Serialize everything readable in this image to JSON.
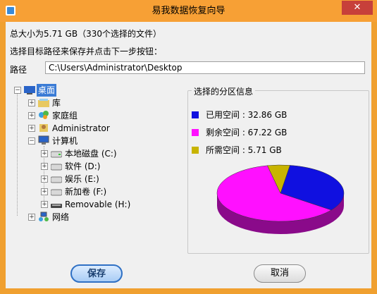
{
  "window": {
    "title": "易我数据恢复向导",
    "close_label": "✕"
  },
  "summary": {
    "total_size_text": "总大小为5.71 GB（330个选择的文件）"
  },
  "prompt": {
    "text": "选择目标路径来保存并点击下一步按钮："
  },
  "path": {
    "label": "路径",
    "value": "C:\\Users\\Administrator\\Desktop"
  },
  "tree": {
    "desktop": "桌面",
    "library": "库",
    "homegroup": "家庭组",
    "administrator": "Administrator",
    "computer": "计算机",
    "drive_c": "本地磁盘 (C:)",
    "drive_d": "软件 (D:)",
    "drive_e": "娱乐 (E:)",
    "drive_f": "新加卷 (F:)",
    "drive_h": "Removable (H:)",
    "network": "网络"
  },
  "partition": {
    "title": "选择的分区信息",
    "used": {
      "label": "已用空间 : 32.86 GB",
      "value_gb": 32.86,
      "color": "#1010e0"
    },
    "free": {
      "label": "剩余空间 : 67.22 GB",
      "value_gb": 67.22,
      "color": "#ff10ff"
    },
    "required": {
      "label": "所需空间 : 5.71 GB",
      "value_gb": 5.71,
      "color": "#c8b400"
    }
  },
  "buttons": {
    "save": "保存",
    "cancel": "取消"
  }
}
